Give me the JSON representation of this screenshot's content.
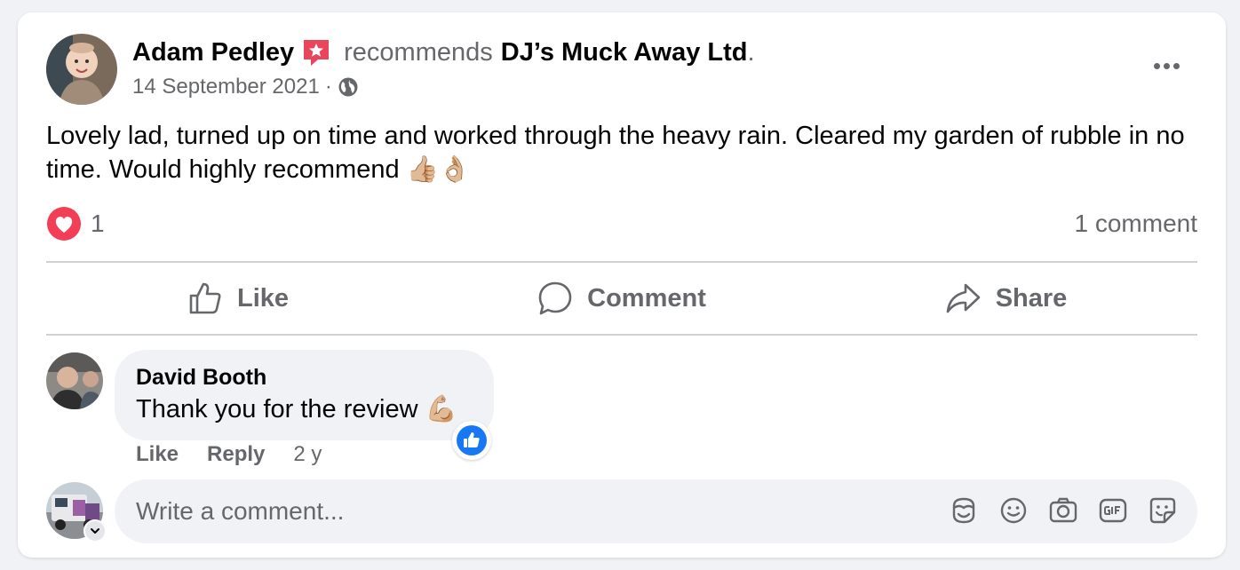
{
  "post": {
    "author": "Adam Pedley",
    "action": "recommends",
    "page": "DJ’s Muck Away Ltd",
    "period": ".",
    "date": "14 September 2021",
    "meta_separator": "·",
    "text": "Lovely lad, turned up on time and worked through the heavy rain. Cleared my garden of rubble in no time. Would highly recommend 👍🏼👌🏼"
  },
  "reactions": {
    "count": "1",
    "comments_summary": "1 comment"
  },
  "actions": {
    "like_label": "Like",
    "comment_label": "Comment",
    "share_label": "Share"
  },
  "comment": {
    "author": "David Booth",
    "text": "Thank you for the review 💪🏼",
    "like_label": "Like",
    "reply_label": "Reply",
    "age": "2 y"
  },
  "composer": {
    "placeholder": "Write a comment..."
  },
  "icons": {
    "badge": "recommend-star-icon",
    "privacy": "globe-icon",
    "reaction": "love-reaction-icon",
    "comment_reaction": "like-reaction-icon",
    "tools": [
      "avatar-sticker-icon",
      "emoji-icon",
      "camera-icon",
      "gif-icon",
      "sticker-icon"
    ]
  },
  "colors": {
    "accent": "#1877f2",
    "love": "#f33e58",
    "recommend": "#e9465d",
    "secondary_text": "#65676b"
  }
}
